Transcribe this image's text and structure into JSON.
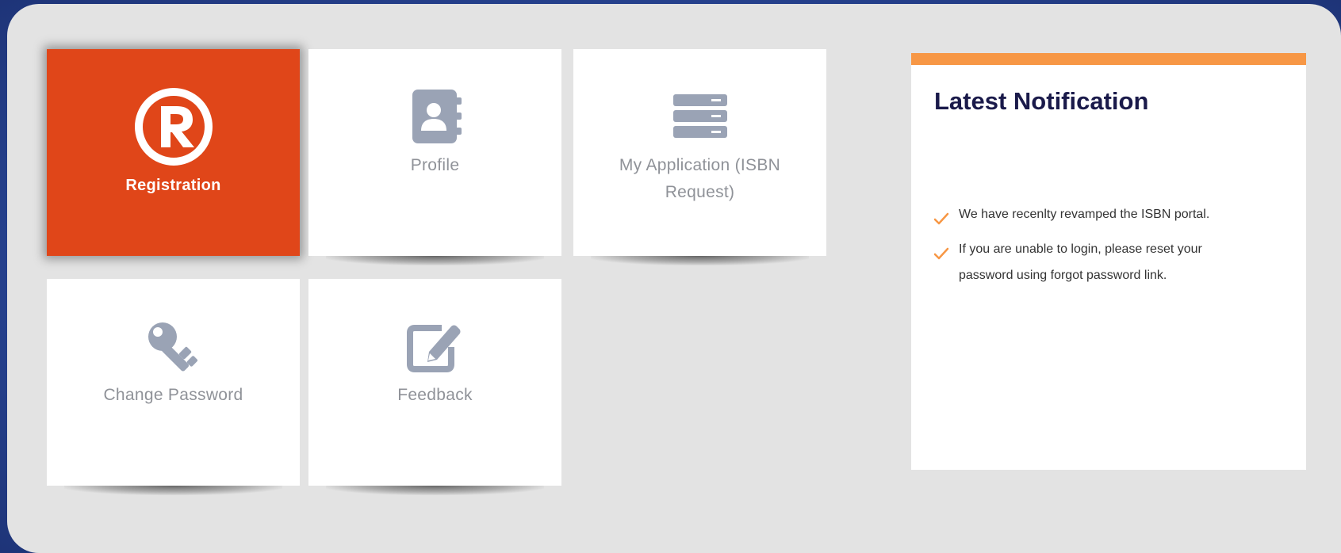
{
  "tiles": {
    "registration": {
      "label": "Registration",
      "icon": "registered-trademark-icon",
      "active": true
    },
    "profile": {
      "label": "Profile",
      "icon": "address-book-icon"
    },
    "my_application": {
      "label_line1": "My Application (ISBN",
      "label_line2": "Request)",
      "icon": "server-stack-icon"
    },
    "change_password": {
      "label": "Change Password",
      "icon": "key-icon"
    },
    "feedback": {
      "label": "Feedback",
      "icon": "edit-icon"
    }
  },
  "notification": {
    "title": "Latest Notification",
    "items": [
      {
        "line1": "We have recenlty revamped the ISBN portal."
      },
      {
        "line1": "If you are unable to login, please reset your",
        "line2": "password using forgot password link."
      }
    ]
  },
  "colors": {
    "active_tile": "#e04619",
    "notification_accent": "#f79745",
    "icon_gray": "#9aa3b5",
    "label_gray": "#8f9298",
    "title_navy": "#1a1a4a",
    "backdrop_blue": "#2b4a9a"
  }
}
